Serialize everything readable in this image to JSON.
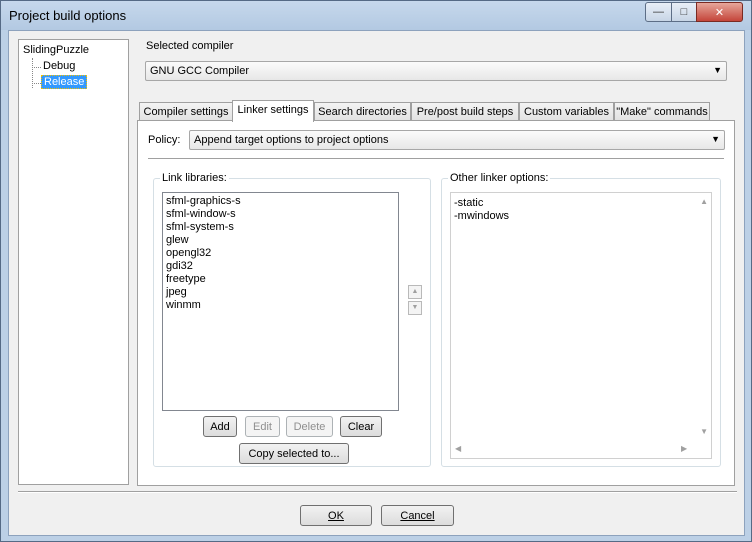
{
  "window": {
    "title": "Project build options",
    "controls": {
      "minimize": "—",
      "maximize": "□",
      "close": "✕"
    }
  },
  "tree": {
    "root": "SlidingPuzzle",
    "children": [
      "Debug",
      "Release"
    ],
    "selected": "Release"
  },
  "compiler": {
    "label": "Selected compiler",
    "value": "GNU GCC Compiler"
  },
  "tabs": [
    {
      "label": "Compiler settings",
      "active": false
    },
    {
      "label": "Linker settings",
      "active": true
    },
    {
      "label": "Search directories",
      "active": false
    },
    {
      "label": "Pre/post build steps",
      "active": false
    },
    {
      "label": "Custom variables",
      "active": false
    },
    {
      "label": "\"Make\" commands",
      "active": false
    }
  ],
  "policy": {
    "label": "Policy:",
    "value": "Append target options to project options"
  },
  "link_libraries": {
    "title": "Link libraries:",
    "items": [
      "sfml-graphics-s",
      "sfml-window-s",
      "sfml-system-s",
      "glew",
      "opengl32",
      "gdi32",
      "freetype",
      "jpeg",
      "winmm"
    ],
    "buttons": {
      "add": "Add",
      "edit": "Edit",
      "delete": "Delete",
      "clear": "Clear",
      "copy": "Copy selected to..."
    }
  },
  "other_linker_options": {
    "title": "Other linker options:",
    "lines": [
      "-static",
      "-mwindows"
    ]
  },
  "footer": {
    "ok": "OK",
    "cancel": "Cancel"
  },
  "colors": {
    "selection": "#3399ff",
    "frame": "#bcd0e6",
    "close_button": "#c4453a"
  }
}
